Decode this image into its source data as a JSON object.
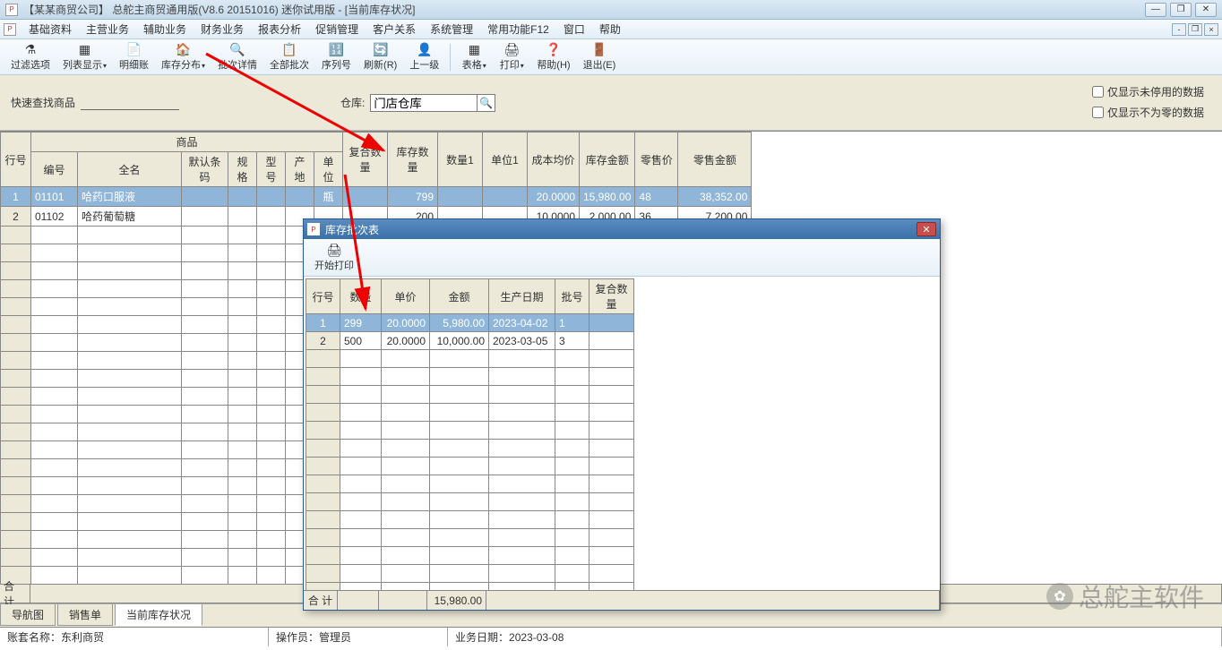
{
  "title": "【某某商贸公司】  总舵主商贸通用版(V8.6 20151016) 迷你试用版 - [当前库存状况]",
  "menus": [
    "基础资料",
    "主营业务",
    "辅助业务",
    "财务业务",
    "报表分析",
    "促销管理",
    "客户关系",
    "系统管理",
    "常用功能F12",
    "窗口",
    "帮助"
  ],
  "toolbar": [
    {
      "label": "过滤选项",
      "icon": "⚗"
    },
    {
      "label": "列表显示",
      "icon": "▦",
      "drop": true
    },
    {
      "label": "明细账",
      "icon": "📄"
    },
    {
      "label": "库存分布",
      "icon": "🏠",
      "drop": true
    },
    {
      "label": "批次详情",
      "icon": "🔍"
    },
    {
      "label": "全部批次",
      "icon": "📋"
    },
    {
      "label": "序列号",
      "icon": "🔢"
    },
    {
      "label": "刷新(R)",
      "icon": "🔄"
    },
    {
      "label": "上一级",
      "icon": "👤"
    },
    {
      "sep": true
    },
    {
      "label": "表格",
      "icon": "▦",
      "drop": true
    },
    {
      "label": "打印",
      "icon": "🖨",
      "drop": true
    },
    {
      "label": "帮助(H)",
      "icon": "❓"
    },
    {
      "label": "退出(E)",
      "icon": "🚪"
    }
  ],
  "filter": {
    "quick_search_label": "快速查找商品",
    "warehouse_label": "仓库:",
    "warehouse_value": "门店仓库",
    "chk1": "仅显示未停用的数据",
    "chk2": "仅显示不为零的数据"
  },
  "main_table": {
    "header_group": "商品",
    "cols_top": [
      "行号",
      "编号",
      "全名",
      "默认条码",
      "规格",
      "型号",
      "产地",
      "单位",
      "复合数量",
      "库存数量",
      "数量1",
      "单位1",
      "成本均价",
      "库存金额",
      "零售价",
      "零售金额"
    ],
    "widths": [
      34,
      52,
      116,
      52,
      32,
      32,
      32,
      32,
      50,
      56,
      50,
      50,
      58,
      62,
      48,
      82
    ],
    "rows": [
      {
        "row": "1",
        "code": "01101",
        "name": "哈药口服液",
        "unit": "瓶",
        "stock_qty": "799",
        "cost": "20.0000",
        "stock_amt": "15,980.00",
        "retail": "48",
        "retail_amt": "38,352.00",
        "selected": true
      },
      {
        "row": "2",
        "code": "01102",
        "name": "哈药葡萄糖",
        "unit": "",
        "stock_qty": "200",
        "cost": "10.0000",
        "stock_amt": "2,000.00",
        "retail": "36",
        "retail_amt": "7,200.00",
        "selected": false
      }
    ],
    "total_label": "合  计"
  },
  "modal": {
    "title": "库存批次表",
    "print_label": "开始打印",
    "cols": [
      "行号",
      "数量",
      "单价",
      "金额",
      "生产日期",
      "批号",
      "复合数量"
    ],
    "widths": [
      38,
      46,
      54,
      66,
      74,
      38,
      50
    ],
    "rows": [
      {
        "row": "1",
        "qty": "299",
        "price": "20.0000",
        "amt": "5,980.00",
        "date": "2023-04-02",
        "batch": "1",
        "selected": true
      },
      {
        "row": "2",
        "qty": "500",
        "price": "20.0000",
        "amt": "10,000.00",
        "date": "2023-03-05",
        "batch": "3",
        "selected": false
      }
    ],
    "total_label": "合  计",
    "total_amt": "15,980.00"
  },
  "tabs": [
    "导航图",
    "销售单",
    "当前库存状况"
  ],
  "status": {
    "acct_label": "账套名称：",
    "acct": "东利商贸",
    "op_label": "操作员：",
    "op": "管理员",
    "date_label": "业务日期：",
    "date": "2023-03-08"
  },
  "watermark": "总舵主软件"
}
